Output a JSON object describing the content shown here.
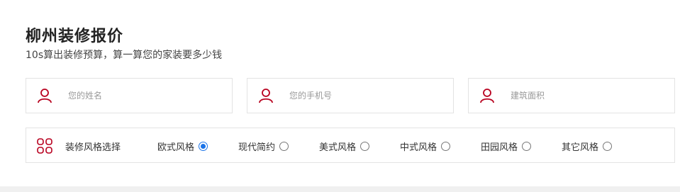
{
  "header": {
    "title": "柳州装修报价",
    "subtitle": "10s算出装修预算，算一算您的家装要多少钱"
  },
  "form": {
    "fields": [
      {
        "icon": "user-icon",
        "placeholder": "您的姓名",
        "value": ""
      },
      {
        "icon": "user-icon",
        "placeholder": "您的手机号",
        "value": ""
      },
      {
        "icon": "user-icon",
        "placeholder": "建筑面积",
        "value": ""
      }
    ],
    "style_select": {
      "icon": "grid-icon",
      "label": "装修风格选择",
      "options": [
        {
          "label": "欧式风格",
          "checked": true
        },
        {
          "label": "现代简约",
          "checked": false
        },
        {
          "label": "美式风格",
          "checked": false
        },
        {
          "label": "中式风格",
          "checked": false
        },
        {
          "label": "田园风格",
          "checked": false
        },
        {
          "label": "其它风格",
          "checked": false
        }
      ]
    }
  },
  "colors": {
    "icon_accent": "#b8001f",
    "radio_checked": "#1a73e8"
  }
}
